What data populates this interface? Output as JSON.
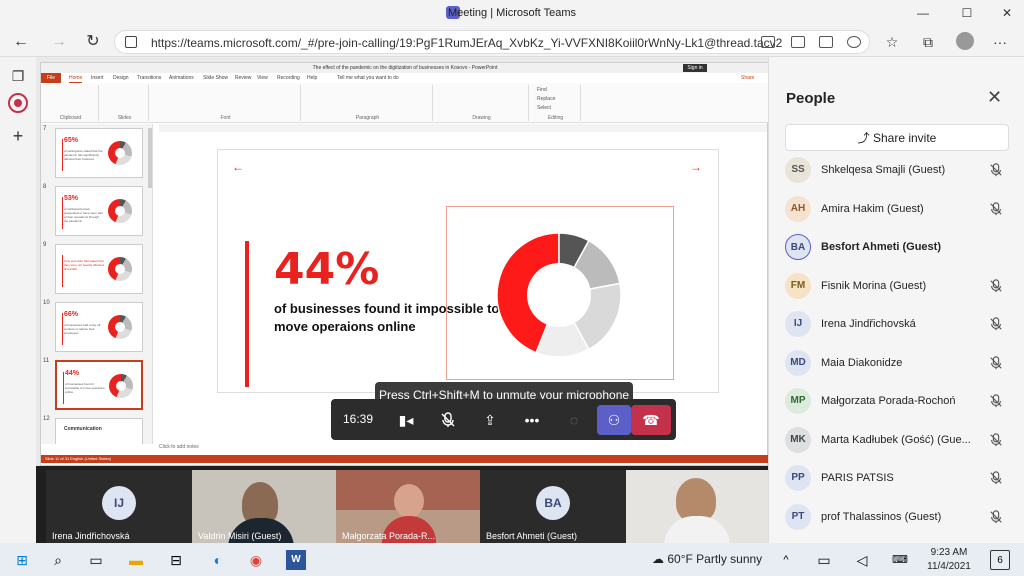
{
  "window": {
    "title": "Meeting | Microsoft Teams",
    "min": "—",
    "max": "☐",
    "close": "✕"
  },
  "browser": {
    "url": "https://teams.microsoft.com/_#/pre-join-calling/19:PgF1RumJErAq_XvbKz_Yi-VVFXNI8Koiil0rWnNy-Lk1@thread.tacv2",
    "menu": "···"
  },
  "ppt": {
    "doc_title": "The effect of the pandemic on the digitization of businesses in Kosovo  -  PowerPoint",
    "sign_in": "Sign in",
    "tabs": [
      "File",
      "Home",
      "Insert",
      "Design",
      "Transitions",
      "Animations",
      "Slide Show",
      "Review",
      "View",
      "Recording",
      "Help"
    ],
    "tell_me": "Tell me what you want to do",
    "share": "Share",
    "groups": [
      "Clipboard",
      "Slides",
      "Font",
      "Paragraph",
      "Drawing",
      "Editing"
    ],
    "editing": [
      "Find",
      "Replace",
      "Select"
    ],
    "notes": "Click to add notes",
    "status": "Slide 11 of 31   English (United States)",
    "thumbnails": [
      {
        "num": "7",
        "pct": "65%",
        "text": "of participants stated that the pandemic has significantly affected their business"
      },
      {
        "num": "8",
        "pct": "53%",
        "text": "of participants have suspended or have seen part of their operations through the pandemic"
      },
      {
        "num": "9",
        "pct": "",
        "text": "Only less than half stated that they were not heavily affected financially"
      },
      {
        "num": "10",
        "pct": "66%",
        "text": "of businesses had to lay off workers or reduce their employees"
      },
      {
        "num": "11",
        "pct": "44%",
        "text": "of businesses found it impossible to move operaions online"
      },
      {
        "num": "12",
        "pct": "",
        "text": "Communication"
      }
    ],
    "slide": {
      "big_pct": "44%",
      "headline": "of businesses found it impossible to move operaions online",
      "arrow_left": "←",
      "arrow_right": "→"
    }
  },
  "chart_data": {
    "type": "pie",
    "title": "",
    "values": [
      44,
      8,
      14,
      20,
      14
    ],
    "colors": [
      "#ff1a1a",
      "#555555",
      "#bbbbbb",
      "#d9d9d9",
      "#eeeeee"
    ]
  },
  "meeting": {
    "toast": "Press Ctrl+Shift+M to unmute your microphone",
    "time": "16:39",
    "people_panel": {
      "title": "People",
      "share_invite": "Share invite",
      "participants": [
        {
          "initials": "SS",
          "name": "Shkelqesa Smajli (Guest)",
          "bg": "#e8e4d8",
          "fg": "#555",
          "muted": true
        },
        {
          "initials": "AH",
          "name": "Amira Hakim (Guest)",
          "bg": "#f6e2d0",
          "fg": "#8a5a2e",
          "muted": true
        },
        {
          "initials": "BA",
          "name": "Besfort Ahmeti (Guest)",
          "bg": "#dfe4f3",
          "fg": "#3b4a7a",
          "muted": false,
          "bold": true
        },
        {
          "initials": "FM",
          "name": "Fisnik Morina (Guest)",
          "bg": "#f6e2c4",
          "fg": "#7a5a20",
          "muted": true
        },
        {
          "initials": "IJ",
          "name": "Irena Jindřichovská",
          "bg": "#dfe4f3",
          "fg": "#3b4a7a",
          "muted": true
        },
        {
          "initials": "MD",
          "name": "Maia Diakonidze",
          "bg": "#dfe4f3",
          "fg": "#3b4a7a",
          "muted": true
        },
        {
          "initials": "MP",
          "name": "Małgorzata Porada-Rochoń",
          "bg": "#dcebdd",
          "fg": "#2e6b34",
          "muted": true
        },
        {
          "initials": "MK",
          "name": "Marta Kadłubek (Gość) (Gue...",
          "bg": "#dde0e2",
          "fg": "#444",
          "muted": true
        },
        {
          "initials": "PP",
          "name": "PARIS PATSIS",
          "bg": "#dfe4f3",
          "fg": "#3b4a7a",
          "muted": true
        },
        {
          "initials": "PT",
          "name": "prof Thalassinos (Guest)",
          "bg": "#dfe4f3",
          "fg": "#3b4a7a",
          "muted": true
        }
      ]
    },
    "video_tiles": [
      {
        "name": "Irena Jindřichovská",
        "initials": "IJ"
      },
      {
        "name": "Valdrin Misiri (Guest)",
        "initials": ""
      },
      {
        "name": "Małgorzata Porada-R...",
        "initials": ""
      },
      {
        "name": "Besfort Ahmeti (Guest)",
        "initials": "BA"
      },
      {
        "name": "",
        "initials": ""
      }
    ],
    "presenter_label": "Besfort Ahmeti (Guest)"
  },
  "taskbar": {
    "weather": "60°F  Partly sunny",
    "time": "9:23 AM",
    "date": "11/4/2021",
    "notif": "6"
  }
}
